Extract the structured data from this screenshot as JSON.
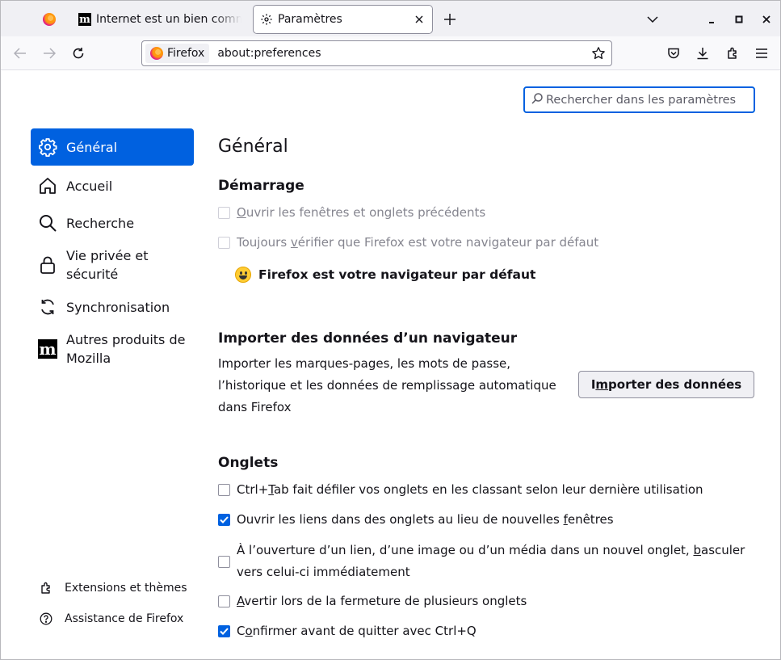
{
  "tabs": {
    "pinned": {
      "icon": "firefox-icon"
    },
    "internet": {
      "title": "Internet est un bien commun",
      "icon": "mozilla-m-icon"
    },
    "active": {
      "title": "Paramètres",
      "icon": "gear-icon"
    }
  },
  "nav": {
    "identity_label": "Firefox",
    "url": "about:preferences"
  },
  "search": {
    "placeholder": "Rechercher dans les paramètres"
  },
  "sidebar": {
    "items": [
      {
        "label": "Général",
        "icon": "gear-icon",
        "selected": true
      },
      {
        "label": "Accueil",
        "icon": "home-icon"
      },
      {
        "label": "Recherche",
        "icon": "search-icon"
      },
      {
        "label_line1": "Vie privée et",
        "label_line2": "sécurité",
        "icon": "lock-icon"
      },
      {
        "label": "Synchronisation",
        "icon": "sync-icon"
      },
      {
        "label_line1": "Autres produits de",
        "label_line2": "Mozilla",
        "icon": "mozilla-m-icon"
      }
    ],
    "footer": {
      "extensions": "Extensions et thèmes",
      "support": "Assistance de Firefox"
    }
  },
  "main": {
    "title": "Général",
    "startup": {
      "heading": "Démarrage",
      "restore_session": {
        "label_pre": "",
        "label_accel": "O",
        "label_post": "uvrir les fenêtres et onglets précédents",
        "checked": false,
        "disabled": true
      },
      "check_default": {
        "label_pre": "Toujours ",
        "label_accel": "v",
        "label_post": "érifier que Firefox est votre navigateur par défaut",
        "checked": false,
        "disabled": true
      },
      "is_default": "Firefox est votre navigateur par défaut"
    },
    "import": {
      "heading": "Importer des données d’un navigateur",
      "desc_line1": "Importer les marques-pages, les mots de passe,",
      "desc_line2": "l’historique et les données de remplissage automatique",
      "desc_line3": "dans Firefox",
      "button_pre": "I",
      "button_accel": "m",
      "button_post": "porter des données"
    },
    "tabs_section": {
      "heading": "Onglets",
      "ctrl_tab": {
        "label_pre": "Ctrl+",
        "label_accel": "T",
        "label_post": "ab fait défiler vos onglets en les classant selon leur dernière utilisation",
        "checked": false
      },
      "open_links": {
        "label_pre": "Ouvrir les liens dans des onglets au lieu de nouvelles ",
        "label_accel": "f",
        "label_post": "enêtres",
        "checked": true
      },
      "switch_to": {
        "line1_pre": "À l’ouverture d’un lien, d’une image ou d’un média dans un nouvel onglet, ",
        "line1_accel": "b",
        "line1_post": "asculer",
        "line2": "vers celui-ci immédiatement",
        "checked": false
      },
      "warn_close": {
        "label_pre": "",
        "label_accel": "A",
        "label_post": "vertir lors de la fermeture de plusieurs onglets",
        "checked": false
      },
      "confirm_quit": {
        "label_pre": "C",
        "label_accel": "o",
        "label_post": "nfirmer avant de quitter avec Ctrl+Q",
        "checked": true
      }
    }
  },
  "colors": {
    "accent": "#0061e0",
    "tabstrip": "#f0f0f4",
    "text": "#15141a",
    "disabled_text": "#85858f"
  }
}
